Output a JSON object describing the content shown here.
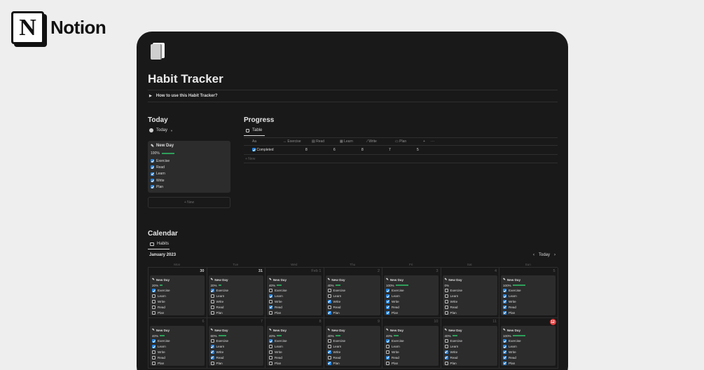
{
  "brand": {
    "logo_letter": "N",
    "name": "Notion"
  },
  "page": {
    "title": "Habit Tracker",
    "toggle": "How to use this Habit Tracker?"
  },
  "today": {
    "heading": "Today",
    "view_label": "Today",
    "card": {
      "title": "New Day",
      "percent": "100%",
      "progress": 1.0,
      "habits": [
        {
          "label": "Exercise",
          "checked": true
        },
        {
          "label": "Read",
          "checked": true
        },
        {
          "label": "Learn",
          "checked": true
        },
        {
          "label": "Write",
          "checked": true
        },
        {
          "label": "Plan",
          "checked": true
        }
      ]
    },
    "new_label": "+ New"
  },
  "progress": {
    "heading": "Progress",
    "view_label": "Table",
    "columns": [
      "Aa",
      "Exercise",
      "Read",
      "Learn",
      "Write",
      "Plan",
      "+",
      "···"
    ],
    "row": {
      "name": "Completed",
      "values": [
        "8",
        "6",
        "8",
        "7",
        "5"
      ]
    },
    "new_label": "+ New"
  },
  "calendar": {
    "heading": "Calendar",
    "view_label": "Habits",
    "month": "January 2023",
    "today_button": "Today",
    "weekdays": [
      "Mon",
      "Tue",
      "Wed",
      "Thu",
      "Fri",
      "Sat",
      "Sun"
    ],
    "weeks": [
      [
        {
          "num": "30",
          "muted": false,
          "percent": "20%",
          "progress": 0.2,
          "checks": [
            true,
            false,
            false,
            false,
            false
          ]
        },
        {
          "num": "31",
          "muted": false,
          "percent": "20%",
          "progress": 0.2,
          "checks": [
            true,
            false,
            false,
            false,
            false
          ]
        },
        {
          "num": "Feb 1",
          "muted": true,
          "percent": "40%",
          "progress": 0.4,
          "checks": [
            false,
            true,
            false,
            true,
            false
          ]
        },
        {
          "num": "2",
          "muted": true,
          "percent": "40%",
          "progress": 0.4,
          "checks": [
            false,
            false,
            true,
            false,
            true
          ]
        },
        {
          "num": "3",
          "muted": true,
          "percent": "100%",
          "progress": 1.0,
          "checks": [
            true,
            true,
            true,
            true,
            true
          ]
        },
        {
          "num": "4",
          "muted": true,
          "percent": "0%",
          "progress": 0.0,
          "checks": [
            false,
            false,
            false,
            false,
            false
          ]
        },
        {
          "num": "5",
          "muted": true,
          "percent": "100%",
          "progress": 1.0,
          "checks": [
            true,
            true,
            true,
            true,
            true
          ]
        }
      ],
      [
        {
          "num": "6",
          "muted": true,
          "percent": "40%",
          "progress": 0.4,
          "checks": [
            true,
            true,
            false,
            false,
            false
          ]
        },
        {
          "num": "7",
          "muted": true,
          "percent": "60%",
          "progress": 0.6,
          "checks": [
            false,
            true,
            true,
            true,
            false
          ]
        },
        {
          "num": "8",
          "muted": true,
          "percent": "40%",
          "progress": 0.4,
          "checks": [
            true,
            false,
            false,
            false,
            false
          ]
        },
        {
          "num": "9",
          "muted": true,
          "percent": "40%",
          "progress": 0.4,
          "checks": [
            false,
            false,
            true,
            false,
            true
          ]
        },
        {
          "num": "10",
          "muted": true,
          "percent": "40%",
          "progress": 0.4,
          "checks": [
            true,
            false,
            false,
            true,
            false
          ]
        },
        {
          "num": "11",
          "muted": true,
          "percent": "40%",
          "progress": 0.4,
          "checks": [
            false,
            false,
            true,
            true,
            false
          ]
        },
        {
          "num": "12",
          "today": true,
          "percent": "100%",
          "progress": 1.0,
          "checks": [
            true,
            true,
            true,
            true,
            true
          ]
        }
      ]
    ],
    "habit_labels": [
      "Exercise",
      "Learn",
      "Write",
      "Read",
      "Plan"
    ],
    "card_title": "New Day"
  },
  "colors": {
    "accent": "#2383e2",
    "progress": "#2f9e5a",
    "today_badge": "#e03e3e",
    "bg": "#191919",
    "card": "#2c2c2c"
  }
}
